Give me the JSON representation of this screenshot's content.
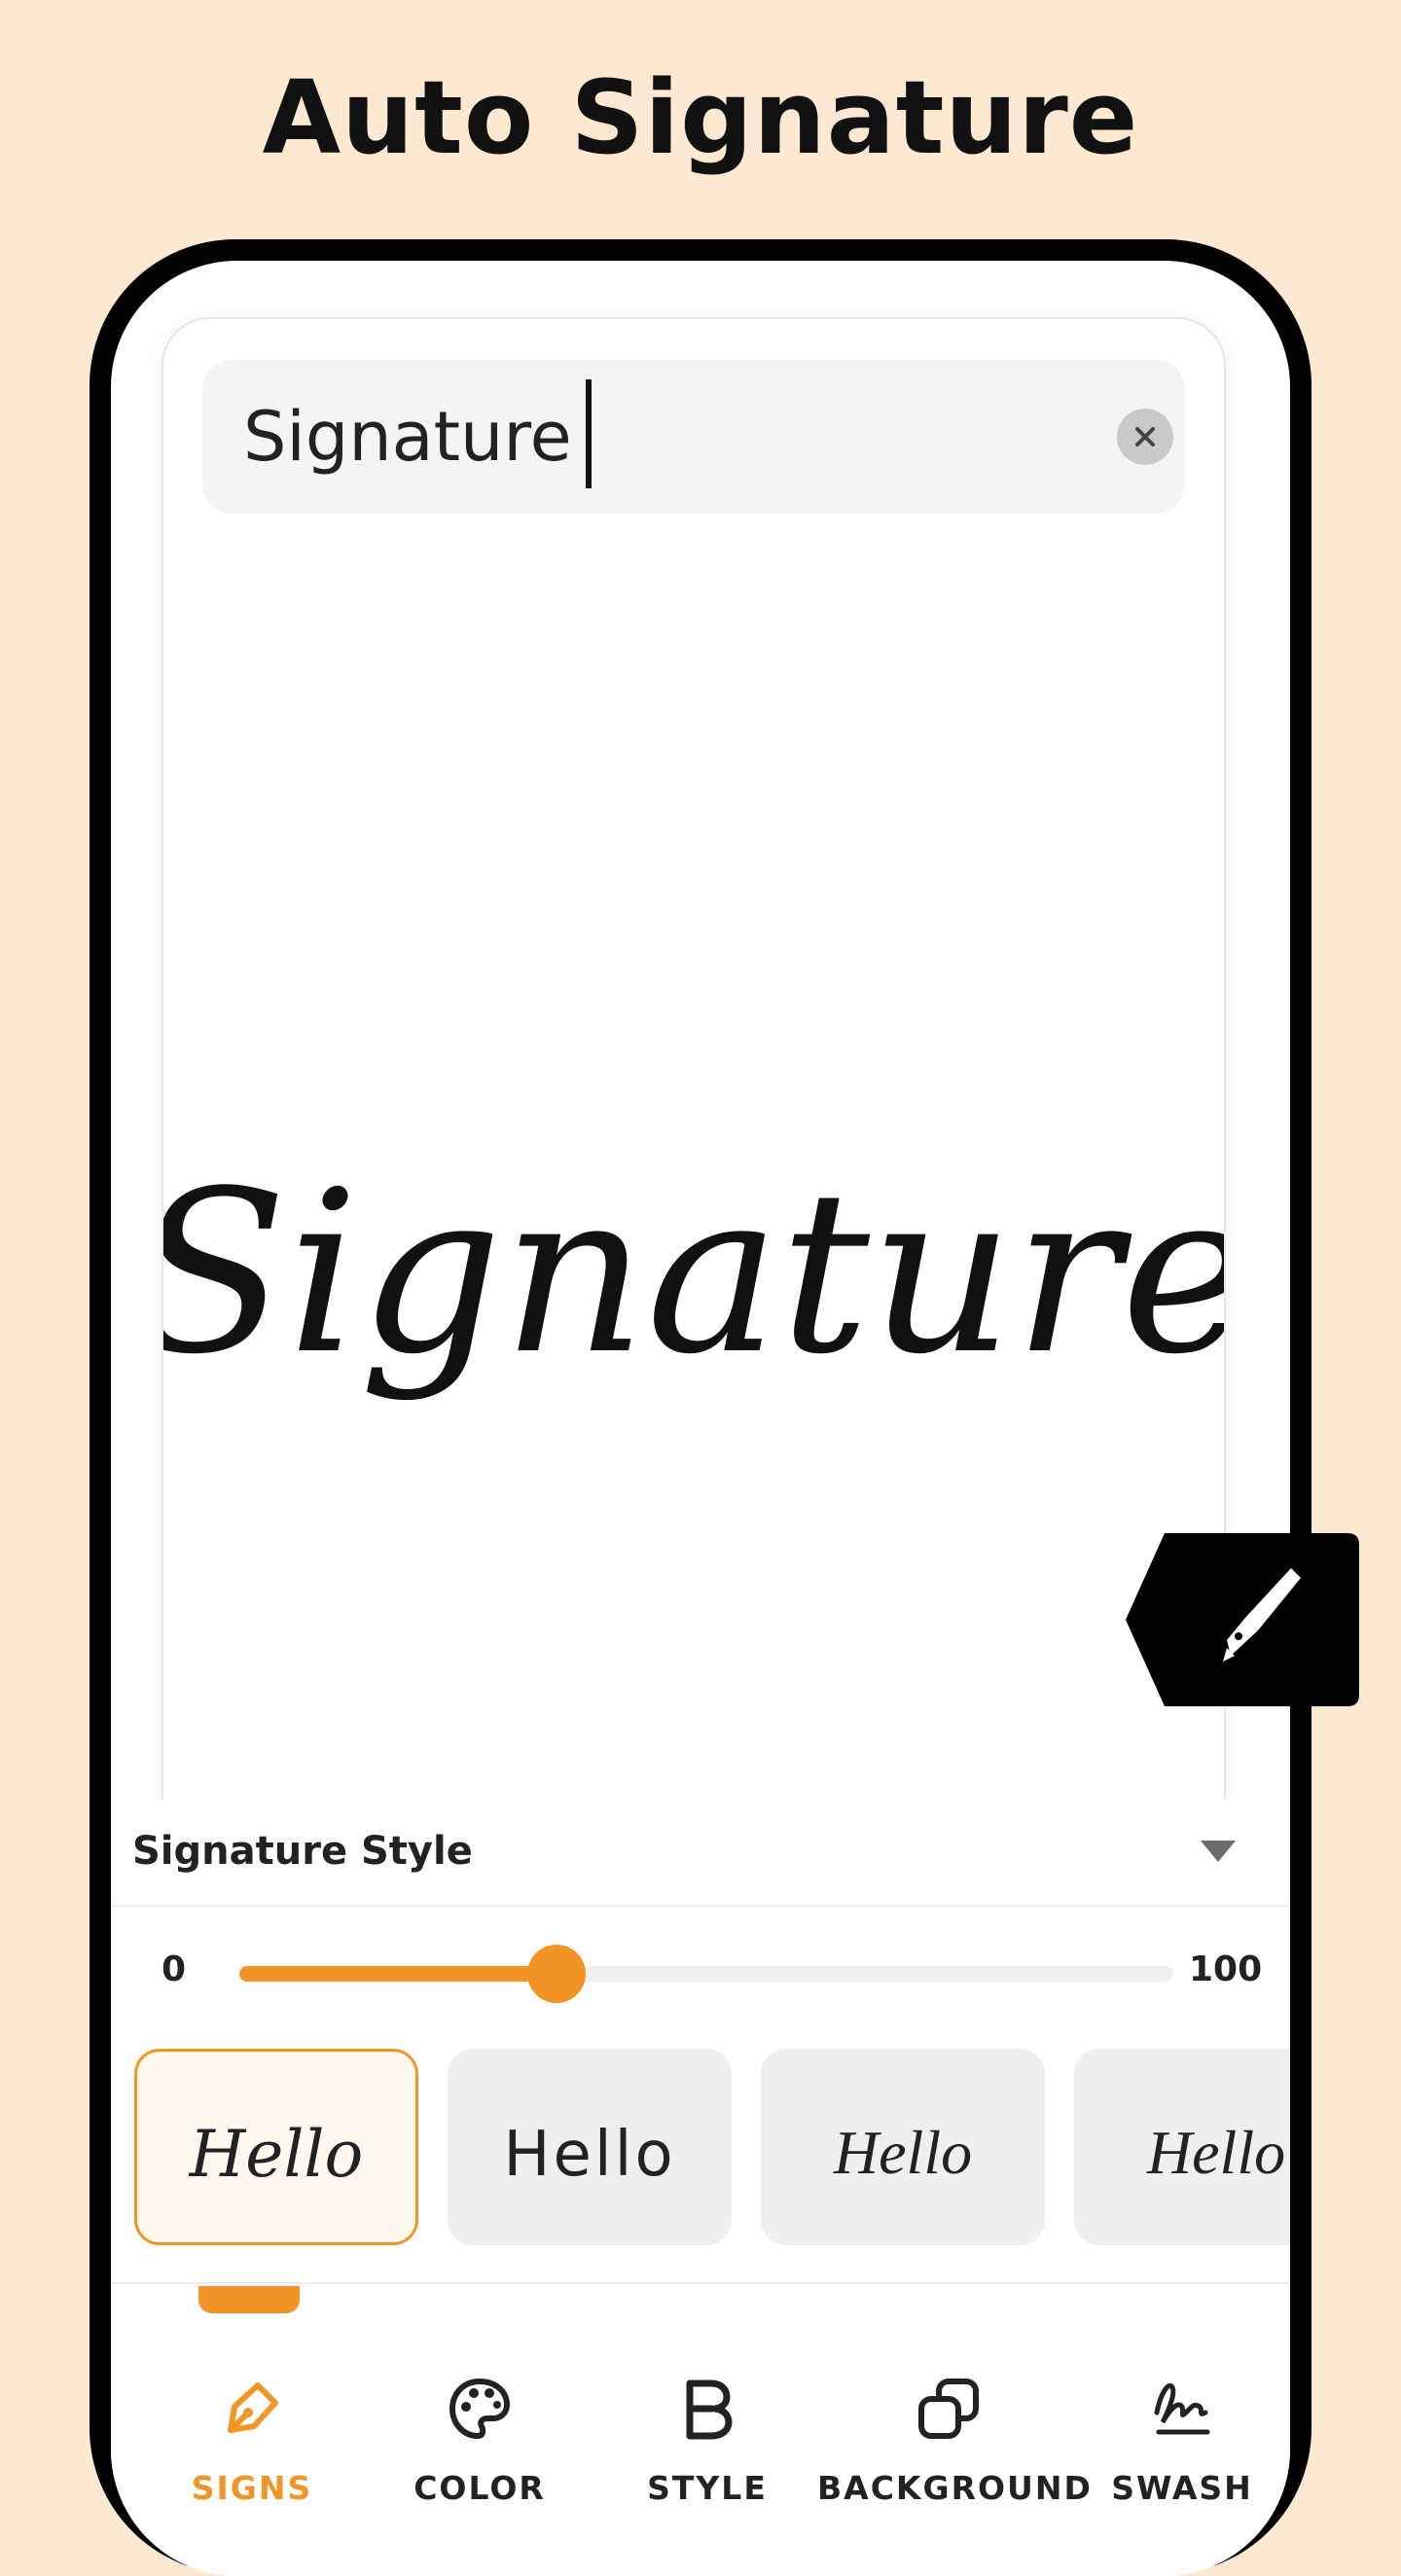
{
  "hero": {
    "title": "Auto Signature"
  },
  "editor": {
    "input_value": "Signature",
    "preview_text": "Signature"
  },
  "panel": {
    "title": "Signature Style",
    "slider": {
      "min_label": "0",
      "max_label": "100",
      "value": 34
    }
  },
  "styles": [
    {
      "label": "Hello",
      "selected": true
    },
    {
      "label": "Hello",
      "selected": false
    },
    {
      "label": "Hello",
      "selected": false
    },
    {
      "label": "Hello",
      "selected": false
    }
  ],
  "nav": {
    "items": [
      {
        "label": "SIGNS",
        "icon": "pen-nib-icon",
        "active": true
      },
      {
        "label": "COLOR",
        "icon": "palette-icon",
        "active": false
      },
      {
        "label": "STYLE",
        "icon": "bold-b-icon",
        "active": false
      },
      {
        "label": "BACKGROUND",
        "icon": "layers-icon",
        "active": false
      },
      {
        "label": "SWASH",
        "icon": "swash-icon",
        "active": false
      }
    ]
  },
  "colors": {
    "accent": "#f39426",
    "background": "#fde9d2",
    "tile": "#efefef"
  }
}
